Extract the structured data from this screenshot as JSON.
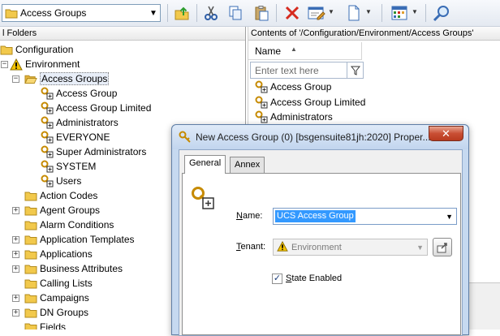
{
  "toolbar": {
    "address_combo": "Access Groups",
    "buttons": [
      "up-folder-icon",
      "cut-icon",
      "copy-icon",
      "paste-icon",
      "delete-icon",
      "edit-icon",
      "new-icon",
      "view-icon",
      "find-icon"
    ]
  },
  "left_pane": {
    "header": "l Folders",
    "tree": [
      {
        "label": "Configuration",
        "icon": "folder-icon"
      },
      {
        "label": "Environment",
        "icon": "warning-icon"
      },
      {
        "label": "Access Groups",
        "icon": "folder-open-icon"
      },
      {
        "label": "Access Group",
        "icon": "access-group-icon"
      },
      {
        "label": "Access Group Limited",
        "icon": "access-group-icon"
      },
      {
        "label": "Administrators",
        "icon": "access-group-icon"
      },
      {
        "label": "EVERYONE",
        "icon": "access-group-icon"
      },
      {
        "label": "Super Administrators",
        "icon": "access-group-icon"
      },
      {
        "label": "SYSTEM",
        "icon": "access-group-icon"
      },
      {
        "label": "Users",
        "icon": "access-group-icon"
      },
      {
        "label": "Action Codes",
        "icon": "folder-icon"
      },
      {
        "label": "Agent Groups",
        "icon": "folder-icon"
      },
      {
        "label": "Alarm Conditions",
        "icon": "folder-icon"
      },
      {
        "label": "Application Templates",
        "icon": "folder-icon"
      },
      {
        "label": "Applications",
        "icon": "folder-icon"
      },
      {
        "label": "Business Attributes",
        "icon": "folder-icon"
      },
      {
        "label": "Calling Lists",
        "icon": "folder-icon"
      },
      {
        "label": "Campaigns",
        "icon": "folder-icon"
      },
      {
        "label": "DN Groups",
        "icon": "folder-icon"
      },
      {
        "label": "Fields",
        "icon": "folder-icon"
      }
    ]
  },
  "right_pane": {
    "header": "Contents of '/Configuration/Environment/Access Groups'",
    "column_name": "Name",
    "filter_placeholder": "Enter text here",
    "items": [
      "Access Group",
      "Access Group Limited",
      "Administrators"
    ]
  },
  "dialog": {
    "title": "New Access Group (0) [bsgensuite81jh:2020] Proper...",
    "close_glyph": "✕",
    "tabs": [
      "General",
      "Annex"
    ],
    "name_label_prefix": "N",
    "name_label_rest": "ame:",
    "name_value": "UCS Access Group",
    "tenant_label_prefix": "T",
    "tenant_label_rest": "enant:",
    "tenant_value": "Environment",
    "state_label_prefix": "S",
    "state_label_rest": "tate Enabled",
    "state_checked": "✓"
  },
  "colors": {
    "folder": "#f2c94c",
    "accent_selected": "#3399ff",
    "close_red": "#c94f34"
  }
}
